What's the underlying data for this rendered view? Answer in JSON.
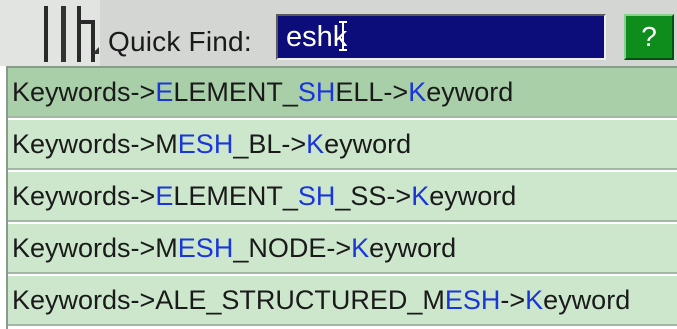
{
  "quick_find": {
    "label": "Quick Find:",
    "value": "eshk",
    "help_label": "?"
  },
  "results": [
    {
      "text": "Keywords->ELEMENT_SHELL->Keyword",
      "segments": [
        {
          "t": "Keywords->",
          "h": false
        },
        {
          "t": "E",
          "h": true
        },
        {
          "t": "LEMENT_",
          "h": false
        },
        {
          "t": "SH",
          "h": true
        },
        {
          "t": "ELL->",
          "h": false
        },
        {
          "t": "K",
          "h": true
        },
        {
          "t": "eyword",
          "h": false
        }
      ],
      "selected": true
    },
    {
      "text": "Keywords->MESH_BL->Keyword",
      "segments": [
        {
          "t": "Keywords->M",
          "h": false
        },
        {
          "t": "ESH",
          "h": true
        },
        {
          "t": "_BL->",
          "h": false
        },
        {
          "t": "K",
          "h": true
        },
        {
          "t": "eyword",
          "h": false
        }
      ],
      "selected": false
    },
    {
      "text": "Keywords->ELEMENT_SH_SS->Keyword",
      "segments": [
        {
          "t": "Keywords->",
          "h": false
        },
        {
          "t": "E",
          "h": true
        },
        {
          "t": "LEMENT_",
          "h": false
        },
        {
          "t": "SH",
          "h": true
        },
        {
          "t": "_SS->",
          "h": false
        },
        {
          "t": "K",
          "h": true
        },
        {
          "t": "eyword",
          "h": false
        }
      ],
      "selected": false
    },
    {
      "text": "Keywords->MESH_NODE->Keyword",
      "segments": [
        {
          "t": "Keywords->M",
          "h": false
        },
        {
          "t": "ESH",
          "h": true
        },
        {
          "t": "_NODE->",
          "h": false
        },
        {
          "t": "K",
          "h": true
        },
        {
          "t": "eyword",
          "h": false
        }
      ],
      "selected": false
    },
    {
      "text": "Keywords->ALE_STRUCTURED_MESH->Keyword",
      "segments": [
        {
          "t": "Keywords->ALE_STRUCTURED_M",
          "h": false
        },
        {
          "t": "ESH",
          "h": true
        },
        {
          "t": "->",
          "h": false
        },
        {
          "t": "K",
          "h": true
        },
        {
          "t": "eyword",
          "h": false
        }
      ],
      "selected": false
    }
  ],
  "colors": {
    "highlight": "#1a35d8",
    "item_bg": "#cde7cd",
    "item_selected_bg": "#a9cfa9",
    "input_bg": "#0c0c7a",
    "help_bg": "#0e8c1c"
  },
  "icons": {
    "toolbar_grip": "toolbar-grip-icon",
    "text_cursor": "text-cursor-icon"
  }
}
